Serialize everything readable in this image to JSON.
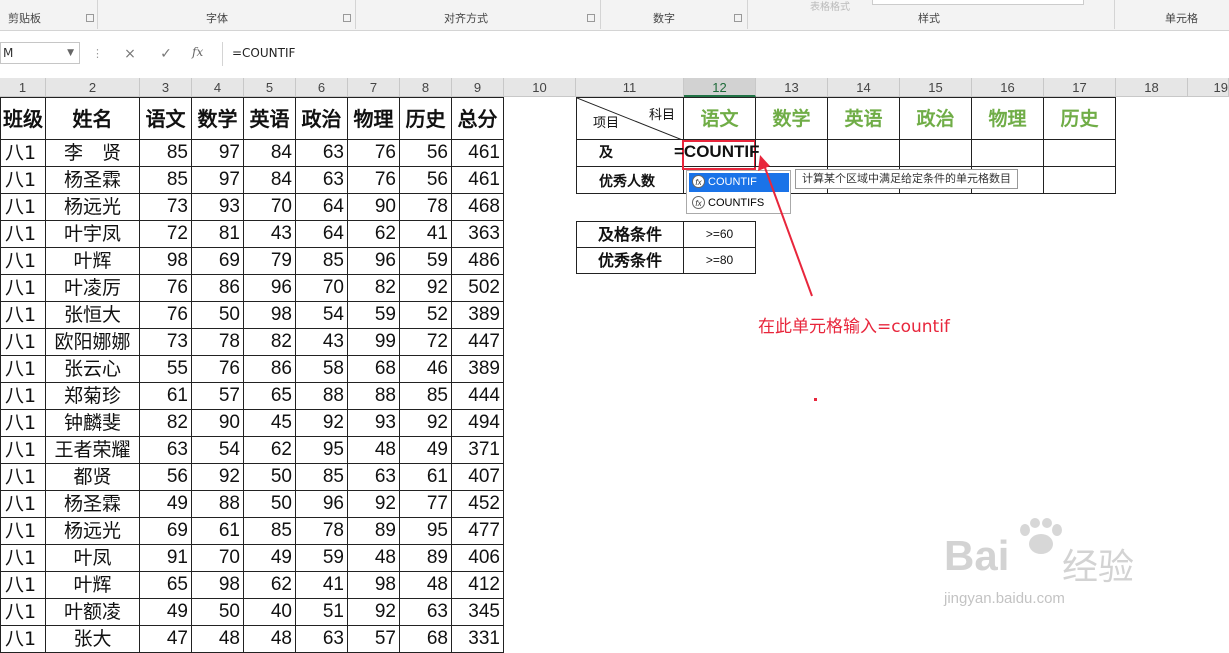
{
  "ribbon": {
    "groups": [
      "剪贴板",
      "字体",
      "对齐方式",
      "数字",
      "样式",
      "单元格"
    ],
    "faint_top": "表格格式"
  },
  "formula_bar": {
    "name_box": "M",
    "cancel_icon": "×",
    "enter_icon": "✓",
    "fx_label": "fx",
    "formula": "=COUNTIF"
  },
  "col_headers": [
    "1",
    "2",
    "3",
    "4",
    "5",
    "6",
    "7",
    "8",
    "9",
    "10",
    "11",
    "12",
    "13",
    "14",
    "15",
    "16",
    "17",
    "18",
    "19"
  ],
  "table": {
    "headers": [
      "班级",
      "姓名",
      "语文",
      "数学",
      "英语",
      "政治",
      "物理",
      "历史",
      "总分"
    ],
    "rows": [
      [
        "八1",
        "李　贤",
        "85",
        "97",
        "84",
        "63",
        "76",
        "56",
        "461"
      ],
      [
        "八1",
        "杨圣霖",
        "85",
        "97",
        "84",
        "63",
        "76",
        "56",
        "461"
      ],
      [
        "八1",
        "杨远光",
        "73",
        "93",
        "70",
        "64",
        "90",
        "78",
        "468"
      ],
      [
        "八1",
        "叶宇凤",
        "72",
        "81",
        "43",
        "64",
        "62",
        "41",
        "363"
      ],
      [
        "八1",
        "叶辉",
        "98",
        "69",
        "79",
        "85",
        "96",
        "59",
        "486"
      ],
      [
        "八1",
        "叶凌厉",
        "76",
        "86",
        "96",
        "70",
        "82",
        "92",
        "502"
      ],
      [
        "八1",
        "张恒大",
        "76",
        "50",
        "98",
        "54",
        "59",
        "52",
        "389"
      ],
      [
        "八1",
        "欧阳娜娜",
        "73",
        "78",
        "82",
        "43",
        "99",
        "72",
        "447"
      ],
      [
        "八1",
        "张云心",
        "55",
        "76",
        "86",
        "58",
        "68",
        "46",
        "389"
      ],
      [
        "八1",
        "郑菊珍",
        "61",
        "57",
        "65",
        "88",
        "88",
        "85",
        "444"
      ],
      [
        "八1",
        "钟麟斐",
        "82",
        "90",
        "45",
        "92",
        "93",
        "92",
        "494"
      ],
      [
        "八1",
        "王者荣耀",
        "63",
        "54",
        "62",
        "95",
        "48",
        "49",
        "371"
      ],
      [
        "八1",
        "都贤",
        "56",
        "92",
        "50",
        "85",
        "63",
        "61",
        "407"
      ],
      [
        "八1",
        "杨圣霖",
        "49",
        "88",
        "50",
        "96",
        "92",
        "77",
        "452"
      ],
      [
        "八1",
        "杨远光",
        "69",
        "61",
        "85",
        "78",
        "89",
        "95",
        "477"
      ],
      [
        "八1",
        "叶凤",
        "91",
        "70",
        "49",
        "59",
        "48",
        "89",
        "406"
      ],
      [
        "八1",
        "叶辉",
        "65",
        "98",
        "62",
        "41",
        "98",
        "48",
        "412"
      ],
      [
        "八1",
        "叶额凌",
        "49",
        "50",
        "40",
        "51",
        "92",
        "63",
        "345"
      ],
      [
        "八1",
        "张大",
        "47",
        "48",
        "48",
        "63",
        "57",
        "68",
        "331"
      ]
    ]
  },
  "stats": {
    "diag_top": "科目",
    "diag_bottom": "项目",
    "subjects": [
      "语文",
      "数学",
      "英语",
      "政治",
      "物理",
      "历史"
    ],
    "pass_label": "及",
    "editing_value": "=COUNTIF",
    "excellent_label": "优秀人数"
  },
  "conditions": {
    "pass_label": "及格条件",
    "pass_value": ">=60",
    "excellent_label": "优秀条件",
    "excellent_value": ">=80"
  },
  "autocomplete": {
    "items": [
      "COUNTIF",
      "COUNTIFS"
    ],
    "tooltip": "计算某个区域中满足给定条件的单元格数目"
  },
  "annotation": "在此单元格输入=countif",
  "accent_colors": {
    "subject": "#70ad47",
    "annotation": "#e8263c",
    "selection": "#1a73e8"
  },
  "watermark": {
    "logo": "Bai",
    "logo_tail": "经验",
    "url": "jingyan.baidu.com"
  }
}
